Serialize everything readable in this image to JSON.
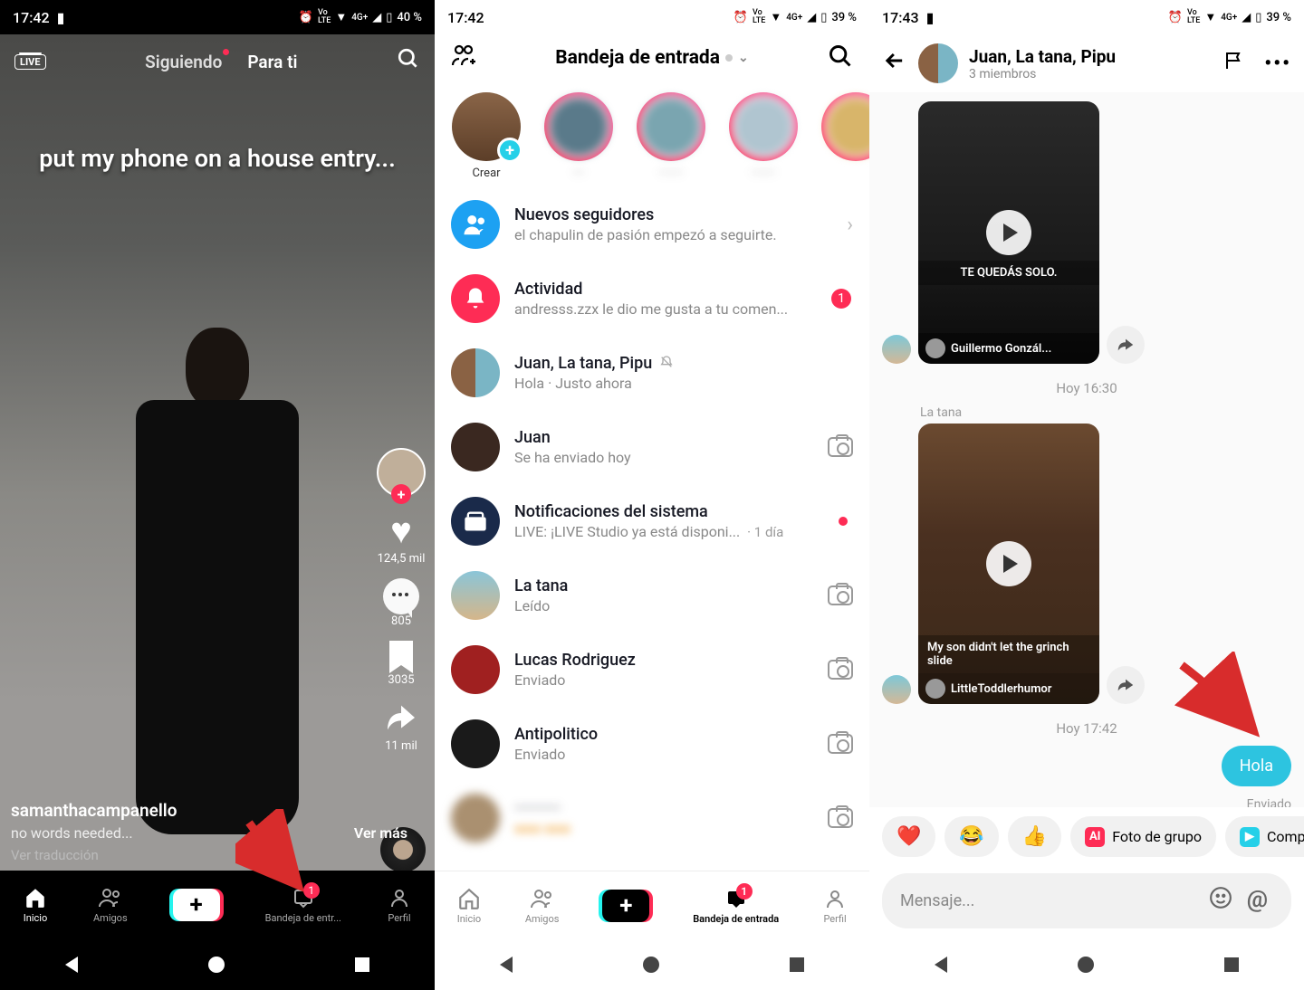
{
  "phone1": {
    "status": {
      "time": "17:42",
      "battery": "40 %"
    },
    "topTabs": {
      "following": "Siguiendo",
      "forYou": "Para ti"
    },
    "liveBadge": "LIVE",
    "overlayCaption": "put my phone on a house entry...",
    "actions": {
      "likes": "124,5 mil",
      "comments": "805",
      "bookmarks": "3035",
      "shares": "11 mil"
    },
    "username": "samanthacampanello",
    "description": "no words needed...",
    "verMas": "Ver más",
    "translate": "Ver traducción",
    "bottomTabs": {
      "home": "Inicio",
      "friends": "Amigos",
      "inbox": "Bandeja de entr...",
      "profile": "Perfil",
      "inboxBadge": "1"
    }
  },
  "phone2": {
    "status": {
      "time": "17:42",
      "battery": "39 %"
    },
    "title": "Bandeja de entrada",
    "createLabel": "Crear",
    "rows": {
      "followers": {
        "title": "Nuevos seguidores",
        "sub": "el chapulin de pasión empezó a seguirte."
      },
      "activity": {
        "title": "Actividad",
        "sub": "andresss.zzx le dio me gusta a tu comen...",
        "badge": "1"
      },
      "group": {
        "title": "Juan, La tana, Pipu",
        "sub": "Hola · Justo ahora"
      },
      "juan": {
        "title": "Juan",
        "sub": "Se ha enviado hoy"
      },
      "system": {
        "title": "Notificaciones del sistema",
        "sub": "LIVE: ¡LIVE Studio ya está disponi...",
        "time": "· 1 día"
      },
      "tana": {
        "title": "La tana",
        "sub": "Leído"
      },
      "lucas": {
        "title": "Lucas Rodriguez",
        "sub": "Enviado"
      },
      "anti": {
        "title": "Antipolitico",
        "sub": "Enviado"
      }
    },
    "bottomTabs": {
      "home": "Inicio",
      "friends": "Amigos",
      "inbox": "Bandeja de entrada",
      "profile": "Perfil",
      "inboxBadge": "1"
    }
  },
  "phone3": {
    "status": {
      "time": "17:43",
      "battery": "39 %"
    },
    "chatTitle": "Juan, La tana, Pipu",
    "chatSub": "3 miembros",
    "video1": {
      "caption": "TE QUEDÁS SOLO.",
      "author": "Guillermo Gonzál..."
    },
    "time1": "Hoy 16:30",
    "sender2": "La tana",
    "video2": {
      "caption": "My son didn't let the grinch slide",
      "author": "LittleToddlerhumor"
    },
    "time2": "Hoy 17:42",
    "bubble": "Hola",
    "sent": "Enviado",
    "suggestions": {
      "photo": "Foto de grupo",
      "share": "Compart"
    },
    "inputPlaceholder": "Mensaje..."
  }
}
